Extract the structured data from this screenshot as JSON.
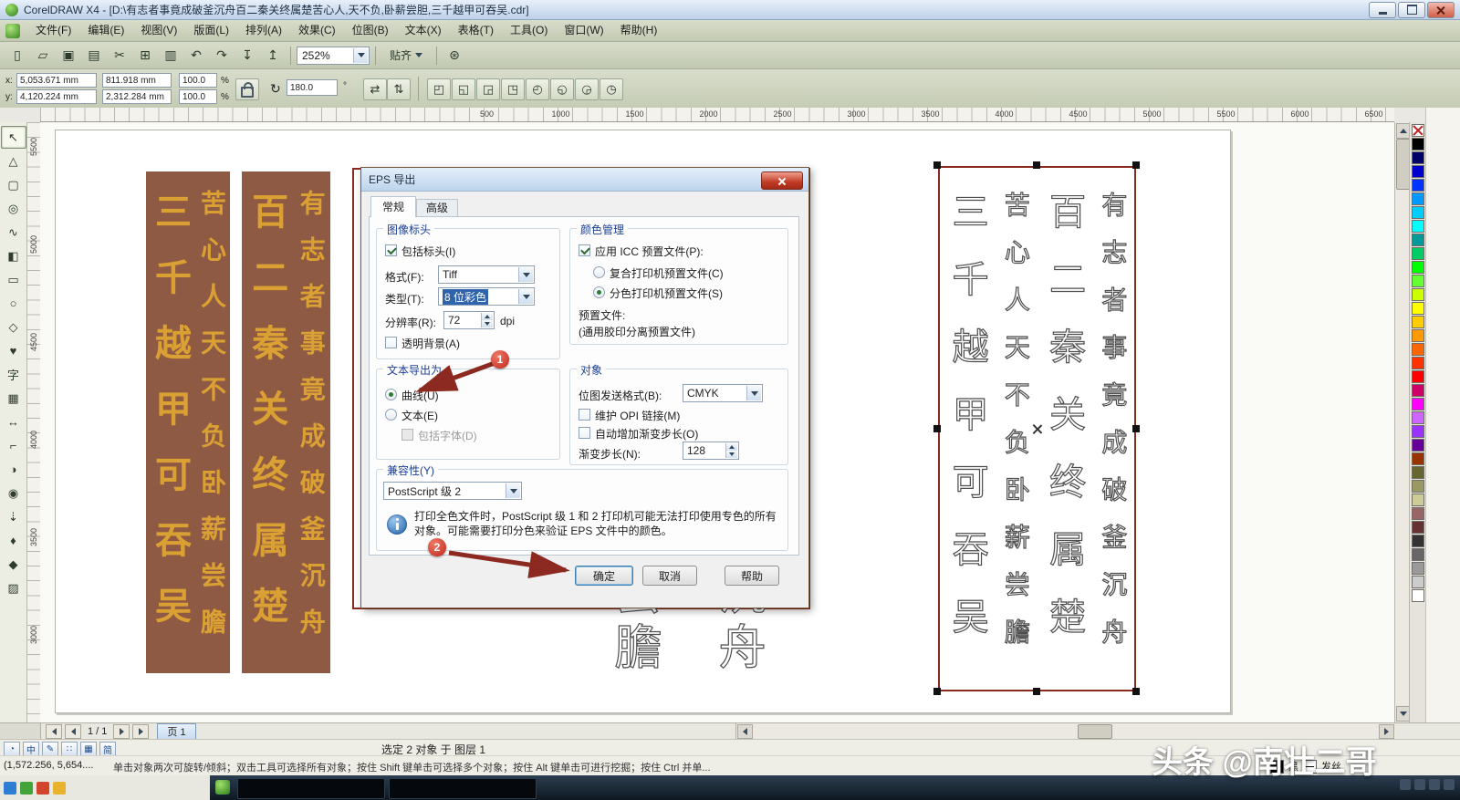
{
  "window": {
    "title": "CorelDRAW X4 - [D:\\有志者事竟成破釜沉舟百二秦关终属楚苦心人,天不负,卧薪尝胆,三千越甲可吞吴.cdr]"
  },
  "menu": {
    "items": [
      {
        "label": "文件(F)"
      },
      {
        "label": "编辑(E)"
      },
      {
        "label": "视图(V)"
      },
      {
        "label": "版面(L)"
      },
      {
        "label": "排列(A)"
      },
      {
        "label": "效果(C)"
      },
      {
        "label": "位图(B)"
      },
      {
        "label": "文本(X)"
      },
      {
        "label": "表格(T)"
      },
      {
        "label": "工具(O)"
      },
      {
        "label": "窗口(W)"
      },
      {
        "label": "帮助(H)"
      }
    ]
  },
  "toolbar": {
    "buttons": [
      {
        "name": "new-document-icon",
        "glyph": "▯"
      },
      {
        "name": "open-icon",
        "glyph": "▱"
      },
      {
        "name": "save-icon",
        "glyph": "▣"
      },
      {
        "name": "print-icon",
        "glyph": "▤"
      },
      {
        "name": "cut-icon",
        "glyph": "✂"
      },
      {
        "name": "copy-icon",
        "glyph": "⊞"
      },
      {
        "name": "paste-icon",
        "glyph": "▥"
      },
      {
        "name": "undo-icon",
        "glyph": "↶"
      },
      {
        "name": "redo-icon",
        "glyph": "↷"
      },
      {
        "name": "import-icon",
        "glyph": "↧"
      },
      {
        "name": "export-icon",
        "glyph": "↥"
      }
    ],
    "zoom_value": "252%",
    "snap_label": "贴齐",
    "options_glyph": "⊛"
  },
  "property_bar": {
    "x_label": "x:",
    "x_value": "5,053.671 mm",
    "y_label": "y:",
    "y_value": "4,120.224 mm",
    "width_value": "811.918 mm",
    "height_value": "2,312.284 mm",
    "scale_x": "100.0",
    "scale_y": "100.0",
    "percent": "%",
    "rotate_glyph": "↻",
    "angle_value": "180.0",
    "angle_unit": "°",
    "mirror_h_glyph": "⇄",
    "mirror_v_glyph": "⇅",
    "extra_buttons": [
      {
        "name": "group-button",
        "glyph": "◰"
      },
      {
        "name": "ungroup-button",
        "glyph": "◱"
      },
      {
        "name": "combine-button",
        "glyph": "◲"
      },
      {
        "name": "weld-button",
        "glyph": "◳"
      },
      {
        "name": "trim-button",
        "glyph": "◴"
      },
      {
        "name": "intersect-button",
        "glyph": "◵"
      },
      {
        "name": "to-front-button",
        "glyph": "◶"
      },
      {
        "name": "to-back-button",
        "glyph": "◷"
      }
    ]
  },
  "rulers": {
    "h": [
      {
        "label": "500"
      },
      {
        "label": "1000"
      },
      {
        "label": "1500"
      },
      {
        "label": "2000"
      },
      {
        "label": "2500"
      },
      {
        "label": "3000"
      },
      {
        "label": "3500"
      },
      {
        "label": "4000"
      },
      {
        "label": "4500"
      },
      {
        "label": "5000"
      },
      {
        "label": "5500"
      },
      {
        "label": "6000"
      },
      {
        "label": "6500"
      }
    ],
    "v": [
      {
        "label": "5500"
      },
      {
        "label": "5000"
      },
      {
        "label": "4500"
      },
      {
        "label": "4000"
      },
      {
        "label": "3500"
      },
      {
        "label": "3000"
      }
    ]
  },
  "toolbox": {
    "tools": [
      {
        "name": "pick-tool",
        "glyph": "↖"
      },
      {
        "name": "shape-tool",
        "glyph": "△"
      },
      {
        "name": "crop-tool",
        "glyph": "▢"
      },
      {
        "name": "zoom-tool",
        "glyph": "◎"
      },
      {
        "name": "freehand-tool",
        "glyph": "∿"
      },
      {
        "name": "smart-fill-tool",
        "glyph": "◧"
      },
      {
        "name": "rectangle-tool",
        "glyph": "▭"
      },
      {
        "name": "ellipse-tool",
        "glyph": "○"
      },
      {
        "name": "polygon-tool",
        "glyph": "◇"
      },
      {
        "name": "basic-shapes-tool",
        "glyph": "♥"
      },
      {
        "name": "text-tool",
        "glyph": "字"
      },
      {
        "name": "table-tool",
        "glyph": "▦"
      },
      {
        "name": "dimension-tool",
        "glyph": "↔"
      },
      {
        "name": "connector-tool",
        "glyph": "⌐"
      },
      {
        "name": "blend-tool",
        "glyph": "◑"
      },
      {
        "name": "contour-tool",
        "glyph": "◉"
      },
      {
        "name": "eyedropper-tool",
        "glyph": "⇣"
      },
      {
        "name": "outline-pen-tool",
        "glyph": "♦"
      },
      {
        "name": "fill-tool",
        "glyph": "◆"
      },
      {
        "name": "interactive-fill-tool",
        "glyph": "▨"
      }
    ]
  },
  "canvas": {
    "banners": [
      {
        "left_column": "三千越甲可吞吴",
        "right_column": "苦心人天不负卧薪尝膽"
      },
      {
        "left_column": "百二秦关终属楚",
        "right_column": "有志者事竟成破釜沉舟"
      }
    ],
    "outline_artwork": {
      "columns": [
        {
          "text": "三千越甲可吞吴",
          "css": "font-size:40px;letter-spacing:34px;"
        },
        {
          "text": "苦心人天不负卧薪尝膽",
          "css": "font-size:28px;letter-spacing:24px;"
        },
        {
          "text": "百二秦关终属楚",
          "css": "font-size:40px;letter-spacing:34px;"
        },
        {
          "text": "有志者事竟成破釜沉舟",
          "css": "font-size:28px;letter-spacing:24px;"
        }
      ]
    },
    "partially_hidden_chars": [
      {
        "text": "尝",
        "css": "left:624px;top:488px;"
      },
      {
        "text": "膽",
        "css": "left:624px;top:548px;"
      },
      {
        "text": "沉",
        "css": "left:738px;top:488px;"
      },
      {
        "text": "舟",
        "css": "left:738px;top:548px;"
      }
    ]
  },
  "dialog": {
    "title": "EPS 导出",
    "tabs": {
      "general": "常规",
      "advanced": "高级"
    },
    "image_header": {
      "legend": "图像标头",
      "include_header": "包括标头(I)",
      "format_label": "格式(F):",
      "format_value": "Tiff",
      "type_label": "类型(T):",
      "type_value": "8 位彩色",
      "resolution_label": "分辨率(R):",
      "resolution_value": "72",
      "resolution_unit": "dpi",
      "transparent_bg": "透明背景(A)"
    },
    "color_management": {
      "legend": "颜色管理",
      "apply_icc": "应用 ICC 预置文件(P):",
      "composite": "复合打印机预置文件(C)",
      "separations": "分色打印机预置文件(S)",
      "profile_label": "预置文件:",
      "profile_value": "(通用胶印分离预置文件)"
    },
    "text_export": {
      "legend": "文本导出为",
      "curves": "曲线(U)",
      "text": "文本(E)",
      "include_fonts": "包括字体(D)"
    },
    "objects": {
      "legend": "对象",
      "bitmap_format_label": "位图发送格式(B):",
      "bitmap_format_value": "CMYK",
      "opi_links": "维护 OPI 链接(M)",
      "auto_fountain": "自动增加渐变步长(O)",
      "fountain_steps_label": "渐变步长(N):",
      "fountain_steps_value": "128"
    },
    "compatibility": {
      "legend": "兼容性(Y)",
      "value": "PostScript 级 2"
    },
    "info_text": "打印全色文件时，PostScript 级 1 和 2 打印机可能无法打印使用专色的所有对象。可能需要打印分色来验证 EPS 文件中的颜色。",
    "buttons": {
      "ok": "确定",
      "cancel": "取消",
      "help": "帮助"
    }
  },
  "annotations": {
    "step1": "1",
    "step2": "2"
  },
  "page_nav": {
    "current": "1 / 1",
    "page_tab": "页 1"
  },
  "status": {
    "selection": "选定 2 对象 于 图层 1",
    "coords": "(1,572.256, 5,654....",
    "hint": "单击对象两次可旋转/倾斜；双击工具可选择所有对象；按住 Shift 键单击可选择多个对象；按住 Alt 键单击可进行挖掘；按住 Ctrl 并单...",
    "fill_label": "黑",
    "outline_label": "发丝",
    "lang_icons": [
      {
        "name": "lang-bar-icon",
        "glyph": "◔"
      },
      {
        "name": "lang-chinese-icon",
        "glyph": "中"
      },
      {
        "name": "lang-pen-icon",
        "glyph": "✎"
      },
      {
        "name": "lang-keyboard-icon",
        "glyph": "∷"
      },
      {
        "name": "lang-panel-icon",
        "glyph": "▦"
      },
      {
        "name": "lang-simplified-icon",
        "glyph": "简"
      }
    ]
  },
  "watermark": {
    "text": "头条 @南壮二哥"
  },
  "palette": {
    "colors": [
      {
        "css": "background:#000000"
      },
      {
        "css": "background:#000066"
      },
      {
        "css": "background:#0000cc"
      },
      {
        "css": "background:#0033ff"
      },
      {
        "css": "background:#0099ff"
      },
      {
        "css": "background:#00ccff"
      },
      {
        "css": "background:#00ffff"
      },
      {
        "css": "background:#009999"
      },
      {
        "css": "background:#00cc66"
      },
      {
        "css": "background:#00ff00"
      },
      {
        "css": "background:#66ff33"
      },
      {
        "css": "background:#ccff00"
      },
      {
        "css": "background:#ffff00"
      },
      {
        "css": "background:#ffcc00"
      },
      {
        "css": "background:#ff9900"
      },
      {
        "css": "background:#ff6600"
      },
      {
        "css": "background:#ff3300"
      },
      {
        "css": "background:#ff0000"
      },
      {
        "css": "background:#cc0066"
      },
      {
        "css": "background:#ff00ff"
      },
      {
        "css": "background:#cc66ff"
      },
      {
        "css": "background:#9933ff"
      },
      {
        "css": "background:#660099"
      },
      {
        "css": "background:#993300"
      },
      {
        "css": "background:#666633"
      },
      {
        "css": "background:#999966"
      },
      {
        "css": "background:#cccc99"
      },
      {
        "css": "background:#996666"
      },
      {
        "css": "background:#663333"
      },
      {
        "css": "background:#333333"
      },
      {
        "css": "background:#666666"
      },
      {
        "css": "background:#999999"
      },
      {
        "css": "background:#cccccc"
      },
      {
        "css": "background:#ffffff"
      }
    ]
  }
}
